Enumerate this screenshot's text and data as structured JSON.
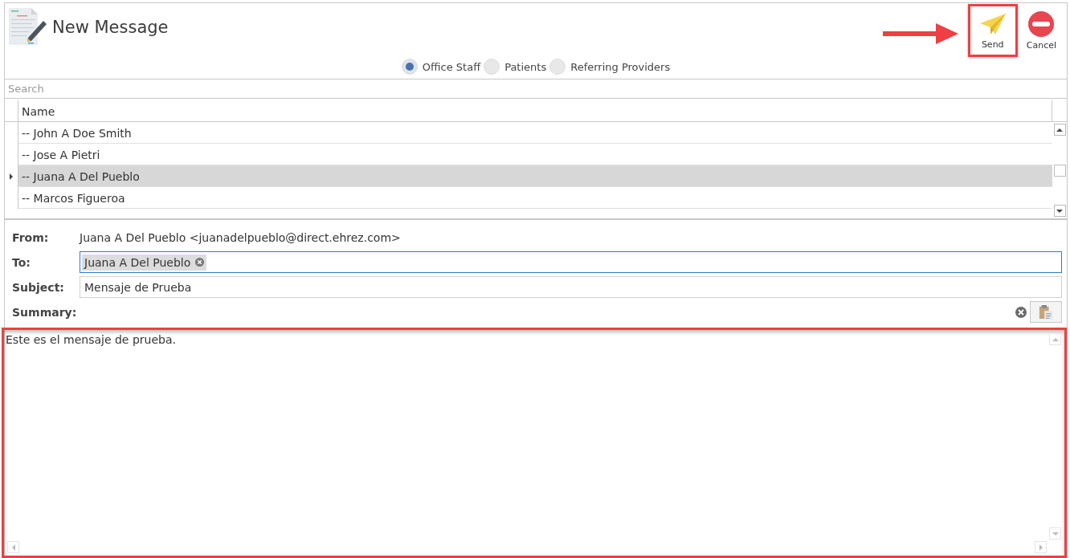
{
  "window": {
    "title": "New Message"
  },
  "toolbar": [
    {
      "kind": "send",
      "label": "Send",
      "highlighted": true,
      "pointer_arrow": true
    },
    {
      "kind": "cancel",
      "label": "Cancel",
      "highlighted": false,
      "pointer_arrow": false
    }
  ],
  "recipient_types": [
    {
      "label": "Office Staff",
      "selected": true
    },
    {
      "label": "Patients",
      "selected": false
    },
    {
      "label": "Referring Providers",
      "selected": false
    }
  ],
  "search": {
    "placeholder": "Search"
  },
  "table": {
    "columns": [
      "Name"
    ],
    "rows": [
      {
        "name": "-- John A Doe Smith",
        "selected": false
      },
      {
        "name": "-- Jose A Pietri",
        "selected": false
      },
      {
        "name": "-- Juana A Del Pueblo",
        "selected": true
      },
      {
        "name": "-- Marcos Figueroa",
        "selected": false
      }
    ]
  },
  "form": {
    "from_label": "From:",
    "from": "Juana A Del Pueblo <juanadelpueblo@direct.ehrez.com>",
    "to_label": "To:",
    "to": [
      "Juana A Del Pueblo"
    ],
    "subject_label": "Subject:",
    "subject": "Mensaje de Prueba",
    "summary_label": "Summary:"
  },
  "body": {
    "text": "Este es el mensaje de prueba.",
    "highlighted": true
  }
}
